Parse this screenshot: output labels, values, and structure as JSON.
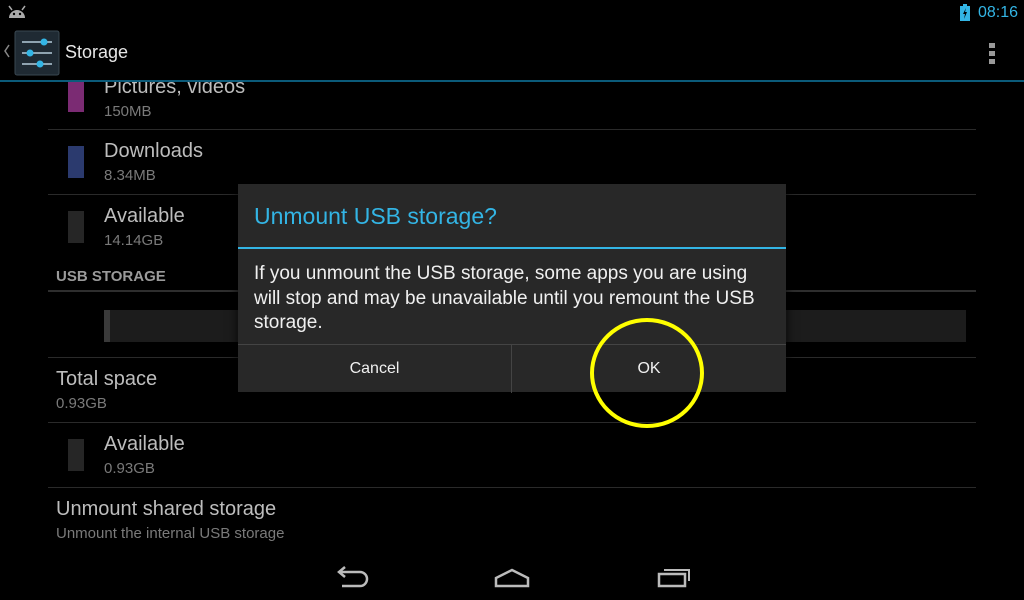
{
  "status_bar": {
    "time": "08:16",
    "icons": [
      "android-debug-icon",
      "battery-charging-icon"
    ]
  },
  "action_bar": {
    "title": "Storage",
    "icons": [
      "up-caret-icon",
      "settings-app-icon",
      "overflow-menu-icon"
    ]
  },
  "list": {
    "internal_items": [
      {
        "label": "Pictures, videos",
        "value": "150MB",
        "color": "#7b2b73"
      },
      {
        "label": "Downloads",
        "value": "8.34MB",
        "color": "#2b3a6e"
      },
      {
        "label": "Available",
        "value": "14.14GB",
        "color": "#262626"
      }
    ],
    "usb_section_header": "USB STORAGE",
    "total_space": {
      "label": "Total space",
      "value": "0.93GB"
    },
    "usb_available": {
      "label": "Available",
      "value": "0.93GB",
      "color": "#262626"
    },
    "unmount": {
      "label": "Unmount shared storage",
      "value": "Unmount the internal USB storage"
    }
  },
  "dialog": {
    "title": "Unmount USB storage?",
    "message": "If you unmount the USB storage, some apps you are using will stop and may be unavailable until you remount the USB storage.",
    "cancel_label": "Cancel",
    "ok_label": "OK",
    "accent_color": "#33b5e5"
  },
  "annotation": {
    "highlight_color": "#ffff00"
  },
  "nav_bar": {
    "icons": [
      "back-icon",
      "home-icon",
      "recent-apps-icon"
    ]
  }
}
